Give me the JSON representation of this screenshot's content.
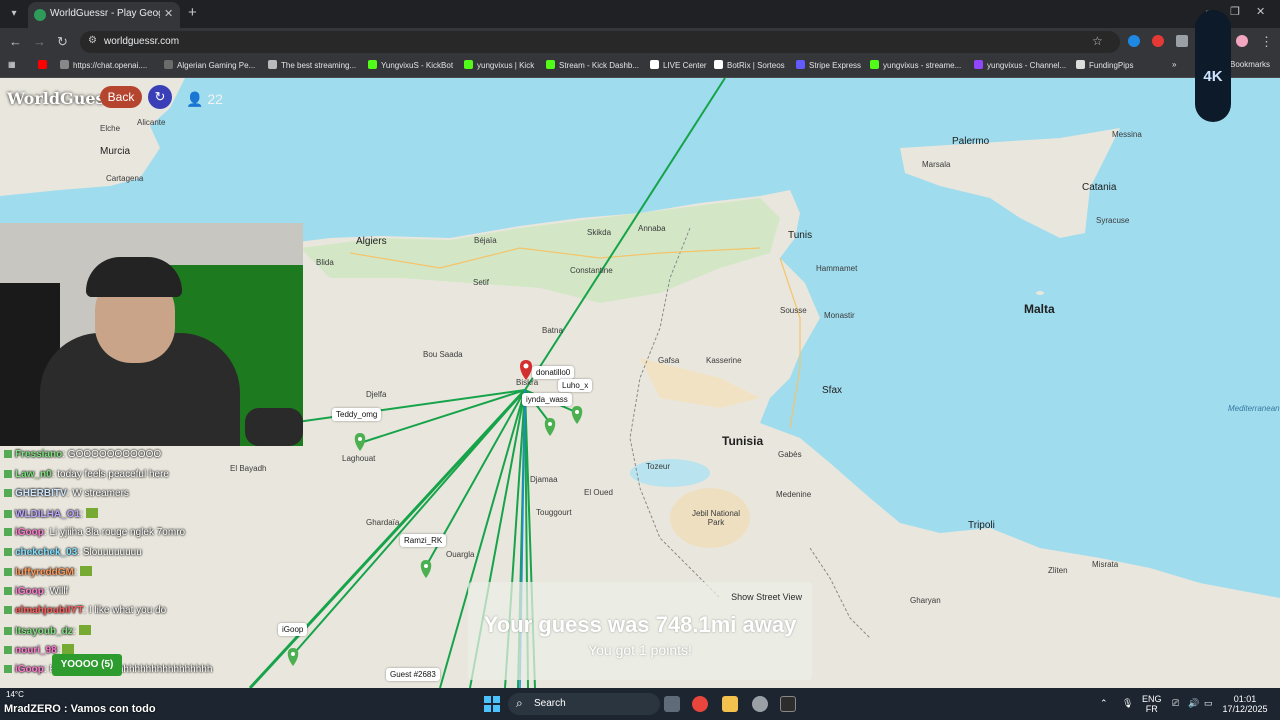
{
  "browser": {
    "tab_title": "WorldGuessr - Play Geoguessr F",
    "url": "worldguessr.com",
    "bookmarks": [
      {
        "label": "https://chat.openai....",
        "color": "#888888"
      },
      {
        "label": "Algerian Gaming Pe...",
        "color": "#6b6b6b"
      },
      {
        "label": "The best streaming...",
        "color": "#bbbbbb"
      },
      {
        "label": "YungvixuS - KickBot",
        "color": "#53fc18"
      },
      {
        "label": "yungvixus | Kick",
        "color": "#53fc18"
      },
      {
        "label": "Stream - Kick Dashb...",
        "color": "#53fc18"
      },
      {
        "label": "LIVE Center",
        "color": "#ffffff"
      },
      {
        "label": "BotRix | Sorteos",
        "color": "#ffffff"
      },
      {
        "label": "Stripe Express",
        "color": "#635bff"
      },
      {
        "label": "yungvixus - streame...",
        "color": "#53fc18"
      },
      {
        "label": "yungvixus - Channel...",
        "color": "#9146ff"
      },
      {
        "label": "FundingPips",
        "color": "#dddddd"
      }
    ],
    "bookmarks_more": "Bookmarks"
  },
  "game": {
    "logo": "WorldGuessr",
    "back_label": "Back",
    "player_count": "22",
    "result_title": "Your guess was 748.1mi away",
    "result_points": "You got 1 points!",
    "show_street_view": "Show Street View",
    "badge": "4K"
  },
  "map": {
    "countries": [
      {
        "name": "Tunisia",
        "size": "big"
      },
      {
        "name": "Malta",
        "size": "big"
      }
    ],
    "places": [
      "Alicante",
      "Elche",
      "Murcia",
      "Cartagena",
      "Algiers",
      "Béjaïa",
      "Annaba",
      "Tunis",
      "Constantine",
      "Skikda",
      "Setif",
      "Batna",
      "Bou Saada",
      "Biskra",
      "Djelfa",
      "Laghouat",
      "Kasserine",
      "Sousse",
      "Monastir",
      "Hammamet",
      "Sfax",
      "Gabès",
      "Medenine",
      "Tripoli",
      "Palermo",
      "Marsala",
      "Catania",
      "Messina",
      "Syracuse",
      "El Oued",
      "Touggourt",
      "Djamaa",
      "Ouargla",
      "Ghardaïa",
      "Gafsa",
      "Tozeur",
      "Jebil National Park",
      "Zliten",
      "Misrata",
      "Gharyan",
      "El Bayadh",
      "Blida",
      "Mediterranean"
    ],
    "players": [
      {
        "name": "donatillo0",
        "pin": "red"
      },
      {
        "name": "Luho_x",
        "pin": "none"
      },
      {
        "name": "iynda_wass",
        "pin": "green"
      },
      {
        "name": "Teddy_omg",
        "pin": "green"
      },
      {
        "name": "Ramzi_RK",
        "pin": "green"
      },
      {
        "name": "iGoop",
        "pin": "green"
      },
      {
        "name": "Guest #2683",
        "pin": "green"
      }
    ]
  },
  "chat": {
    "lines": [
      {
        "user": "Fressiano",
        "msg": ": GOOOOOOOOOOO",
        "color": "#7fe07f"
      },
      {
        "user": "Law_n0",
        "msg": ": today feels peaceful here",
        "color": "#7fe07f"
      },
      {
        "user": "GHERBITV",
        "msg": ": W streamers",
        "color": "#cfe6ff"
      },
      {
        "user": "WLDILHA_O1",
        "msg": ":",
        "color": "#bba7ff"
      },
      {
        "user": "iGoop",
        "msg": ": Li yjiiha 3la rouge nglek 7omro",
        "color": "#ff7ad0"
      },
      {
        "user": "chekchek_03",
        "msg": ": Slouuuuuuuu",
        "color": "#7fe0ff"
      },
      {
        "user": "luffyreddGM",
        "msg": ":",
        "color": "#ff9a5a"
      },
      {
        "user": "iGoop",
        "msg": ": Wlllf",
        "color": "#ff7ad0"
      },
      {
        "user": "elmahjoubiIYT",
        "msg": ": I like what you do",
        "color": "#ff5c5c"
      },
      {
        "user": "Itsayoub_dz",
        "msg": ":",
        "color": "#7fe07f"
      },
      {
        "user": "nouri_98",
        "msg": ":",
        "color": "#ff7ad0"
      },
      {
        "user": "iGoop",
        "msg": ": Hhhhhhhhhhhhhhhhhhhhhhhhhhhhh",
        "color": "#ff7ad0"
      }
    ],
    "yoooo_label": "YOOOO (5)",
    "ticker": "MradZERO : Vamos con todo"
  },
  "taskbar": {
    "search": "Search",
    "lang_top": "ENG",
    "lang_bottom": "FR",
    "time": "01:01",
    "date": "17/12/2025",
    "weather": "14°C"
  },
  "colors": {
    "sea": "#9fdcee",
    "land": "#e9e7dd",
    "guess_line": "#16a34a",
    "accent_back": "#b5452f",
    "accent_refresh": "#3a3fb8"
  }
}
